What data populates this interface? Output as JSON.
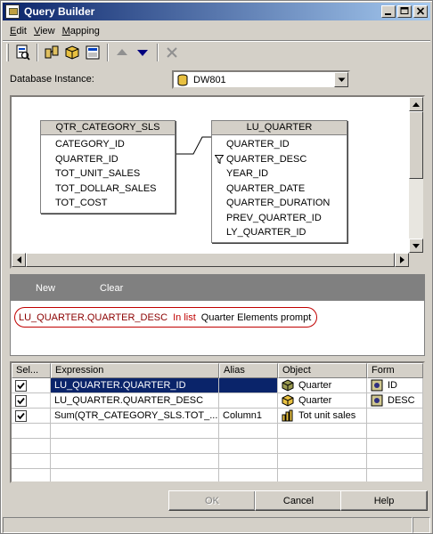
{
  "window": {
    "title": "Query Builder"
  },
  "menu": [
    "Edit",
    "View",
    "Mapping"
  ],
  "toolbar": {
    "buttons": [
      "report-icon",
      "tables-icon",
      "cube-icon",
      "zoom-icon",
      "move-up-icon",
      "move-down-icon",
      "delete-icon"
    ]
  },
  "database": {
    "label": "Database Instance:",
    "value": "DW801"
  },
  "diagram": {
    "tables": [
      {
        "name": "QTR_CATEGORY_SLS",
        "fields": [
          "CATEGORY_ID",
          "QUARTER_ID",
          "TOT_UNIT_SALES",
          "TOT_DOLLAR_SALES",
          "TOT_COST"
        ]
      },
      {
        "name": "LU_QUARTER",
        "fields": [
          "QUARTER_ID",
          "QUARTER_DESC",
          "YEAR_ID",
          "QUARTER_DATE",
          "QUARTER_DURATION",
          "PREV_QUARTER_ID",
          "LY_QUARTER_ID"
        ]
      }
    ]
  },
  "filter": {
    "new_label": "New",
    "clear_label": "Clear",
    "expression": "LU_QUARTER.QUARTER_DESC",
    "operator": "In list",
    "value": "Quarter Elements prompt"
  },
  "grid": {
    "columns": [
      "Sel...",
      "Expression",
      "Alias",
      "Object",
      "Form"
    ],
    "rows": [
      {
        "expression": "LU_QUARTER.QUARTER_ID",
        "alias": "",
        "object": "Quarter",
        "form": "ID"
      },
      {
        "expression": "LU_QUARTER.QUARTER_DESC",
        "alias": "",
        "object": "Quarter",
        "form": "DESC"
      },
      {
        "expression": "Sum(QTR_CATEGORY_SLS.TOT_...",
        "alias": "Column1",
        "object": "Tot unit sales",
        "form": ""
      }
    ]
  },
  "buttons": {
    "ok": "OK",
    "cancel": "Cancel",
    "help": "Help"
  },
  "colors": {
    "titlebar": "#0a246a",
    "selection": "#0a246a",
    "filter_border": "#c00000"
  }
}
